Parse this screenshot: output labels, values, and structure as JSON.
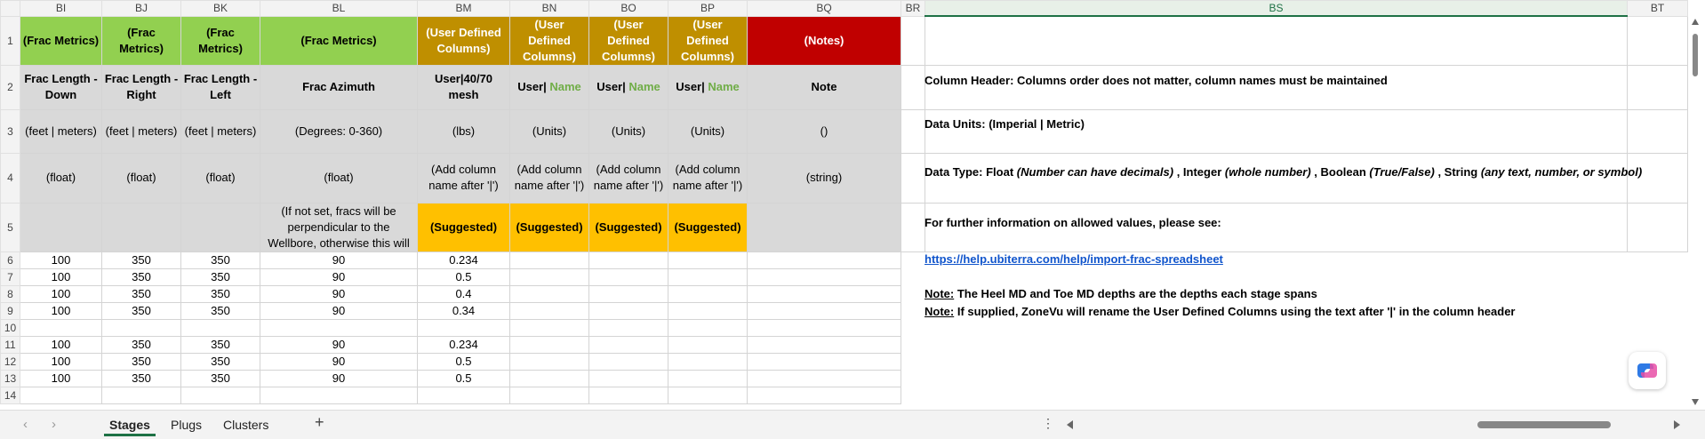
{
  "columns": [
    "BI",
    "BJ",
    "BK",
    "BL",
    "BM",
    "BN",
    "BO",
    "BP",
    "BQ",
    "BR",
    "BS",
    "BT"
  ],
  "rows": {
    "r1": {
      "bi": "(Frac Metrics)",
      "bj": "(Frac Metrics)",
      "bk": "(Frac Metrics)",
      "bl": "(Frac Metrics)",
      "bm": "(User Defined Columns)",
      "bn": "(User Defined Columns)",
      "bo": "(User Defined Columns)",
      "bp": "(User Defined Columns)",
      "bq": "(Notes)"
    },
    "r2": {
      "bi": "Frac Length - Down",
      "bj": "Frac Length - Right",
      "bk": "Frac Length - Left",
      "bl": "Frac Azimuth",
      "bm": "User|40/70 mesh",
      "bn_prefix": "User|",
      "bn_name": "Name",
      "bo_prefix": "User|",
      "bo_name": "Name",
      "bp_prefix": "User|",
      "bp_name": "Name",
      "bq": "Note"
    },
    "r3": {
      "bi": "(feet | meters)",
      "bj": "(feet | meters)",
      "bk": "(feet | meters)",
      "bl": "(Degrees: 0-360)",
      "bm": "(lbs)",
      "bn": "(Units)",
      "bo": "(Units)",
      "bp": "(Units)",
      "bq": "()"
    },
    "r4": {
      "bi": "(float)",
      "bj": "(float)",
      "bk": "(float)",
      "bl": "(float)",
      "bm": "(Add column name after '|')",
      "bn": "(Add column name after '|')",
      "bo": "(Add column name after '|')",
      "bp": "(Add column name after '|')",
      "bq": "(string)"
    },
    "r5": {
      "bl": "(If not set, fracs will be perpendicular to the Wellbore, otherwise this will",
      "bm": "(Suggested)",
      "bn": "(Suggested)",
      "bo": "(Suggested)",
      "bp": "(Suggested)"
    },
    "data": [
      {
        "n": "6",
        "bi": "100",
        "bj": "350",
        "bk": "350",
        "bl": "90",
        "bm": "0.234"
      },
      {
        "n": "7",
        "bi": "100",
        "bj": "350",
        "bk": "350",
        "bl": "90",
        "bm": "0.5"
      },
      {
        "n": "8",
        "bi": "100",
        "bj": "350",
        "bk": "350",
        "bl": "90",
        "bm": "0.4"
      },
      {
        "n": "9",
        "bi": "100",
        "bj": "350",
        "bk": "350",
        "bl": "90",
        "bm": "0.34"
      },
      {
        "n": "10",
        "bi": "",
        "bj": "",
        "bk": "",
        "bl": "",
        "bm": ""
      },
      {
        "n": "11",
        "bi": "100",
        "bj": "350",
        "bk": "350",
        "bl": "90",
        "bm": "0.234"
      },
      {
        "n": "12",
        "bi": "100",
        "bj": "350",
        "bk": "350",
        "bl": "90",
        "bm": "0.5"
      },
      {
        "n": "13",
        "bi": "100",
        "bj": "350",
        "bk": "350",
        "bl": "90",
        "bm": "0.5"
      },
      {
        "n": "14",
        "bi": "",
        "bj": "",
        "bk": "",
        "bl": "",
        "bm": ""
      }
    ]
  },
  "row_numbers": [
    "1",
    "2",
    "3",
    "4",
    "5"
  ],
  "notes": {
    "header_label": "Column Header: Columns order does not matter, column names must be maintained",
    "units_label": "Data Units: (Imperial | Metric)",
    "type_prefix": "Data Type: Float ",
    "type_float": "(Number can have decimals)",
    "type_sep1": " , Integer ",
    "type_int": "(whole number)",
    "type_sep2": " , Boolean ",
    "type_bool": "(True/False)",
    "type_sep3": " , String ",
    "type_str": "(any text, number, or symbol)",
    "info": "For further information on allowed values, please see:",
    "link": "https://help.ubiterra.com/help/import-frac-spreadsheet",
    "note_label": "Note:",
    "note1": " The Heel MD and Toe MD depths are the depths each stage spans",
    "note2": " If supplied, ZoneVu will rename the User Defined Columns using the text after '|' in the column header"
  },
  "tabs": {
    "stages": "Stages",
    "plugs": "Plugs",
    "clusters": "Clusters",
    "add": "+"
  },
  "colors": {
    "green": "#92d050",
    "gold": "#bf8f00",
    "red": "#c00000",
    "yellow": "#ffc000",
    "gray": "#d9d9d9",
    "accent": "#1e7145"
  }
}
